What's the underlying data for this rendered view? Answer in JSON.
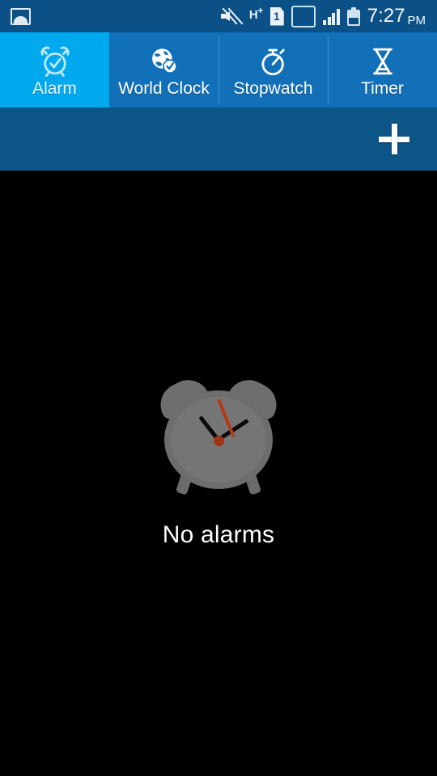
{
  "status_bar": {
    "left_icons": [
      {
        "name": "gallery-icon",
        "label": "Gallery"
      }
    ],
    "right_icons": [
      {
        "name": "sound-mute-icon",
        "label": "Sound off"
      },
      {
        "name": "network-hplus-icon",
        "label": "H+"
      },
      {
        "name": "sim-one-icon",
        "label": "1"
      },
      {
        "name": "signal-bars-active-icon",
        "label": "Signal 1"
      },
      {
        "name": "signal-bars-icon",
        "label": "Signal 2"
      },
      {
        "name": "battery-icon",
        "label": "Battery"
      }
    ],
    "network_label": "H",
    "network_sup": "+",
    "sim_label": "1",
    "time": "7:27",
    "ampm": "PM",
    "background_color": "#0b5187"
  },
  "tabs": {
    "active_index": 0,
    "active_color": "#00a8ee",
    "inactive_color": "#1170b8",
    "items": [
      {
        "label": "Alarm",
        "icon": "alarm-clock-icon"
      },
      {
        "label": "World Clock",
        "icon": "globe-clock-icon"
      },
      {
        "label": "Stopwatch",
        "icon": "stopwatch-icon"
      },
      {
        "label": "Timer",
        "icon": "hourglass-icon"
      }
    ]
  },
  "action_bar": {
    "background_color": "#0b5587",
    "add_button": {
      "name": "add-alarm-button",
      "icon": "plus-icon",
      "label": "Add alarm"
    }
  },
  "main": {
    "background_color": "#000000",
    "empty_state": {
      "illustration": "alarm-clock-illustration",
      "message": "No alarms",
      "text_color": "#ffffff",
      "clock_colors": {
        "body": "#6d6d6d",
        "face": "#757575",
        "bell": "#6e6e6e",
        "hands": "#0a0a0a",
        "second_hand": "#b53a16"
      }
    }
  }
}
